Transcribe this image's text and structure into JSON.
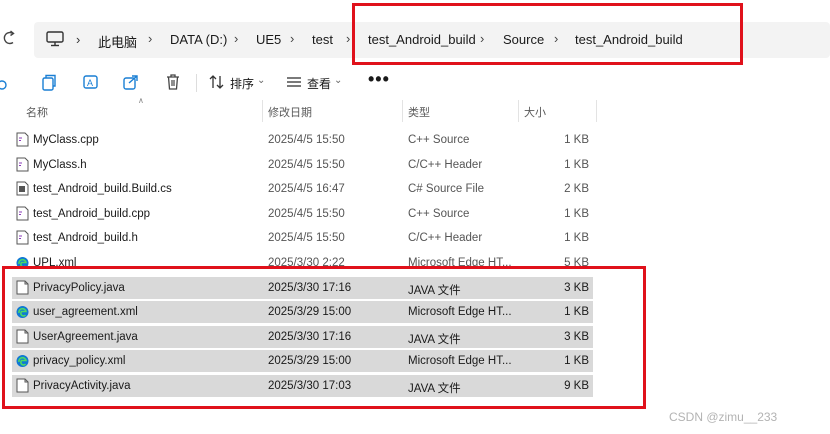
{
  "breadcrumb": {
    "items": [
      "此电脑",
      "DATA (D:)",
      "UE5",
      "test",
      "test_Android_build",
      "Source",
      "test_Android_build"
    ]
  },
  "toolbar": {
    "sort_label": "排序",
    "view_label": "查看",
    "more_label": "•••"
  },
  "columns": {
    "name": "名称",
    "date": "修改日期",
    "type": "类型",
    "size": "大小"
  },
  "files": [
    {
      "name": "MyClass.cpp",
      "date": "2025/4/5 15:50",
      "type": "C++ Source",
      "size": "1 KB",
      "icon": "cpp-file-icon"
    },
    {
      "name": "MyClass.h",
      "date": "2025/4/5 15:50",
      "type": "C/C++ Header",
      "size": "1 KB",
      "icon": "header-file-icon"
    },
    {
      "name": "test_Android_build.Build.cs",
      "date": "2025/4/5 16:47",
      "type": "C# Source File",
      "size": "2 KB",
      "icon": "cs-file-icon"
    },
    {
      "name": "test_Android_build.cpp",
      "date": "2025/4/5 15:50",
      "type": "C++ Source",
      "size": "1 KB",
      "icon": "cpp-file-icon"
    },
    {
      "name": "test_Android_build.h",
      "date": "2025/4/5 15:50",
      "type": "C/C++ Header",
      "size": "1 KB",
      "icon": "header-file-icon"
    },
    {
      "name": "UPL.xml",
      "date": "2025/3/30 2:22",
      "type": "Microsoft Edge HT...",
      "size": "5 KB",
      "icon": "edge-icon"
    },
    {
      "name": "PrivacyPolicy.java",
      "date": "2025/3/30 17:16",
      "type": "JAVA 文件",
      "size": "3 KB",
      "icon": "java-file-icon"
    },
    {
      "name": "user_agreement.xml",
      "date": "2025/3/29 15:00",
      "type": "Microsoft Edge HT...",
      "size": "1 KB",
      "icon": "edge-icon"
    },
    {
      "name": "UserAgreement.java",
      "date": "2025/3/30 17:16",
      "type": "JAVA 文件",
      "size": "3 KB",
      "icon": "java-file-icon"
    },
    {
      "name": "privacy_policy.xml",
      "date": "2025/3/29 15:00",
      "type": "Microsoft Edge HT...",
      "size": "1 KB",
      "icon": "edge-icon"
    },
    {
      "name": "PrivacyActivity.java",
      "date": "2025/3/30 17:03",
      "type": "JAVA 文件",
      "size": "9 KB",
      "icon": "java-file-icon"
    }
  ],
  "watermark": "CSDN @zimu__233",
  "colors": {
    "highlight_border": "#e0111b",
    "selected_row": "#d9d9d9",
    "edge_blue": "#0f78d4"
  }
}
